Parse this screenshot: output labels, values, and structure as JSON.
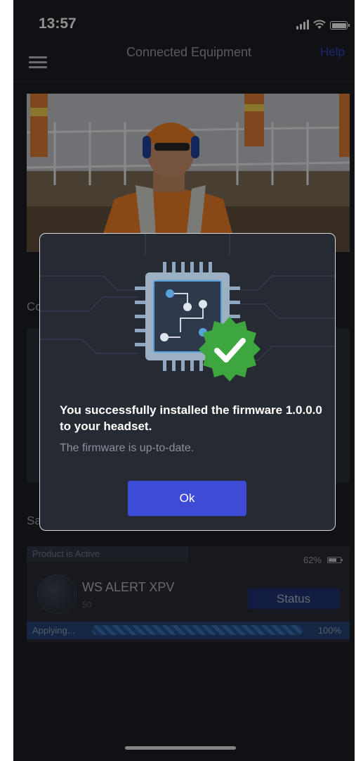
{
  "status_bar": {
    "time": "13:57"
  },
  "nav": {
    "title": "Connected Equipment",
    "help_label": "Help"
  },
  "background": {
    "section_1_partial": "Co",
    "section_2_partial": "Sa",
    "product": {
      "active_label": "Product is Active",
      "battery_percent": "62%",
      "name": "WS ALERT XPV",
      "sub": "50",
      "status_button": "Status",
      "applying_label": "Applying...",
      "progress_percent": "100%"
    }
  },
  "modal": {
    "title": "You successfully installed the firmware 1.0.0.0 to your headset.",
    "subtitle": "The firmware is up-to-date.",
    "ok_label": "Ok",
    "accent_color": "#3d4bd6",
    "success_color": "#3ea63e"
  }
}
